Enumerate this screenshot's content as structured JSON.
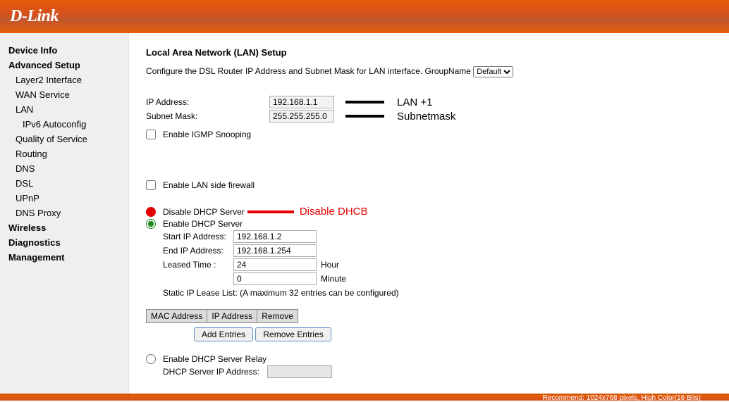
{
  "header": {
    "logo": "D-Link"
  },
  "nav": {
    "device_info": "Device Info",
    "advanced_setup": "Advanced Setup",
    "layer2": "Layer2 Interface",
    "wan_service": "WAN Service",
    "lan": "LAN",
    "ipv6_autoconfig": "IPv6 Autoconfig",
    "qos": "Quality of Service",
    "routing": "Routing",
    "dns": "DNS",
    "dsl": "DSL",
    "upnp": "UPnP",
    "dns_proxy": "DNS Proxy",
    "wireless": "Wireless",
    "diagnostics": "Diagnostics",
    "management": "Management"
  },
  "main": {
    "title": "Local Area Network (LAN) Setup",
    "description_prefix": "Configure the DSL Router IP Address and Subnet Mask for LAN interface.  GroupName ",
    "groupname_selected": "Default",
    "ip_label": "IP Address:",
    "ip_value": "192.168.1.1",
    "mask_label": "Subnet Mask:",
    "mask_value": "255.255.255.0",
    "igmp_label": "Enable IGMP Snooping",
    "firewall_label": "Enable LAN side firewall",
    "disable_dhcp_label": "Disable DHCP Server",
    "enable_dhcp_label": "Enable DHCP Server",
    "start_ip_label": "Start IP Address:",
    "start_ip_value": "192.168.1.2",
    "end_ip_label": "End IP Address:",
    "end_ip_value": "192.168.1.254",
    "leased_label": "Leased Time :",
    "leased_hour": "24",
    "leased_min": "0",
    "hour_unit": "Hour",
    "minute_unit": "Minute",
    "static_list_label": "Static IP Lease List: (A maximum 32 entries can be configured)",
    "tbl_mac": "MAC Address",
    "tbl_ip": "IP Address",
    "tbl_remove": "Remove",
    "btn_add": "Add Entries",
    "btn_remove": "Remove Entries",
    "relay_label": "Enable DHCP Server Relay",
    "relay_addr_label": "DHCP Server IP Address:"
  },
  "annotations": {
    "lan_plus": "LAN +1",
    "subnetmask": "Subnetmask",
    "disable_dhcb": "Disable DHCB"
  },
  "footer": "Recommend: 1024x768 pixels, High Color(16 Bits)"
}
